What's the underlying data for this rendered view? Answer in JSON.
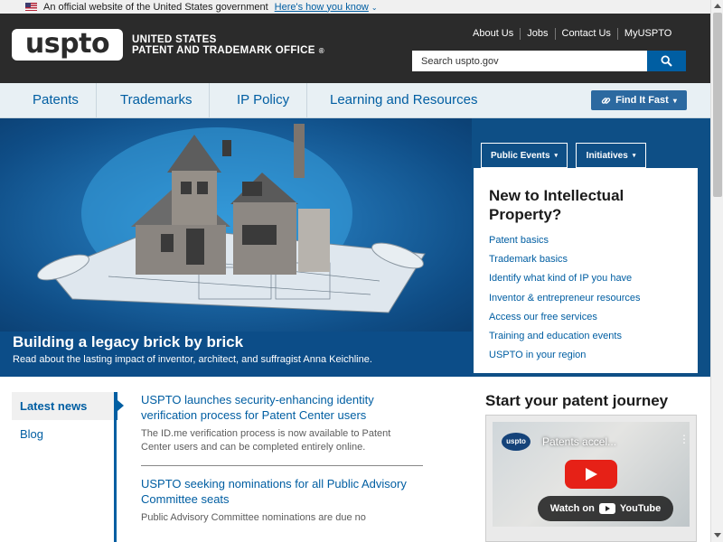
{
  "gov_banner": {
    "text": "An official website of the United States government",
    "link": "Here's how you know"
  },
  "header": {
    "logo": "uspto",
    "agency_line1": "UNITED STATES",
    "agency_line2": "PATENT AND TRADEMARK OFFICE",
    "reg_mark": "®",
    "utility_links": [
      "About Us",
      "Jobs",
      "Contact Us",
      "MyUSPTO"
    ],
    "search_placeholder": "Search uspto.gov"
  },
  "nav": {
    "items": [
      "Patents",
      "Trademarks",
      "IP Policy",
      "Learning and Resources"
    ],
    "find_fast": "Find It Fast"
  },
  "hero": {
    "title": "Building a legacy brick by brick",
    "subtitle": "Read about the lasting impact of inventor, architect, and suffragist Anna Keichline.",
    "buttons": [
      "Public Events",
      "Initiatives"
    ],
    "panel": {
      "title": "New to Intellectual Property?",
      "links": [
        "Patent basics",
        "Trademark basics",
        "Identify what kind of IP you have",
        "Inventor & entrepreneur resources",
        "Access our free services",
        "Training and education events",
        "USPTO in your region"
      ]
    }
  },
  "side_tabs": [
    "Latest news",
    "Blog"
  ],
  "news": [
    {
      "title": "USPTO launches security-enhancing identity verification process for Patent Center users",
      "body": "The ID.me verification process is now available to Patent Center users and can be completed entirely online."
    },
    {
      "title": "USPTO seeking nominations for all Public Advisory Committee seats",
      "body": "Public Advisory Committee nominations are due no"
    }
  ],
  "journey": {
    "title": "Start your patent journey",
    "video_channel": "uspto",
    "video_title": "Patents accel...",
    "watch_label": "Watch on",
    "youtube_label": "YouTube"
  },
  "colors": {
    "brand_blue": "#005ea2",
    "header_dark": "#2b2b2b",
    "hero_blue": "#0e4f86"
  }
}
